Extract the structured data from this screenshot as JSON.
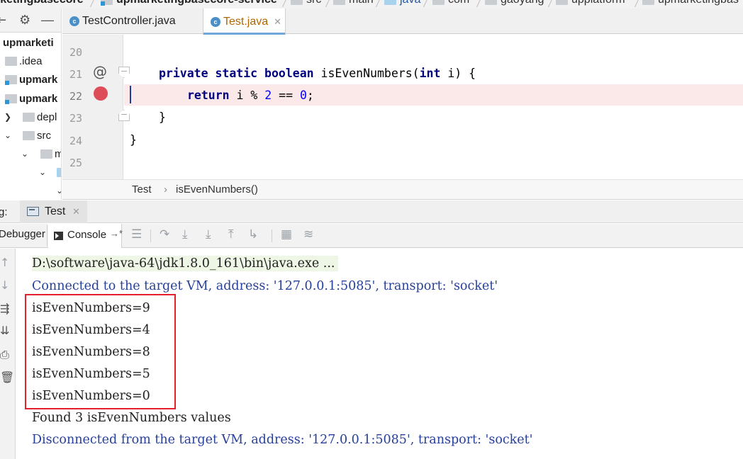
{
  "navbar": {
    "crumbs": [
      {
        "label": "rketingbasecore",
        "kind": "module"
      },
      {
        "label": "upmarketingbasecore-service",
        "kind": "module"
      },
      {
        "label": "src",
        "kind": "folder"
      },
      {
        "label": "main",
        "kind": "folder"
      },
      {
        "label": "java",
        "kind": "source"
      },
      {
        "label": "com",
        "kind": "folder"
      },
      {
        "label": "gaoyang",
        "kind": "folder"
      },
      {
        "label": "upplatform",
        "kind": "folder"
      },
      {
        "label": "upmarketingbas",
        "kind": "folder"
      }
    ]
  },
  "project": {
    "toolbar": {
      "collapse": "⇤",
      "settings": "⚙",
      "hide": "—"
    },
    "items": [
      {
        "label": "upmarketi",
        "bold": true,
        "arrow": ""
      },
      {
        "label": ".idea",
        "bold": false,
        "arrow": ""
      },
      {
        "label": "upmark",
        "bold": true,
        "arrow": ""
      },
      {
        "label": "upmark",
        "bold": true,
        "arrow": ""
      },
      {
        "label": "depl",
        "bold": false,
        "arrow": "❯"
      },
      {
        "label": "src",
        "bold": false,
        "arrow": "⌄"
      },
      {
        "label": "m",
        "bold": false,
        "arrow": "⌄"
      },
      {
        "label": "",
        "bold": false,
        "arrow": "⌄"
      },
      {
        "label": "",
        "bold": false,
        "arrow": "⌄"
      }
    ]
  },
  "tabs": [
    {
      "label": "TestController.java",
      "icon": "class-icon",
      "active": false
    },
    {
      "label": "Test.java",
      "icon": "class-icon",
      "active": true
    }
  ],
  "editor": {
    "lines": [
      {
        "num": "20",
        "code": ""
      },
      {
        "num": "21",
        "code": "private static boolean isEvenNumbers(int i) {"
      },
      {
        "num": "22",
        "code": "return i % 2 == 0;"
      },
      {
        "num": "23",
        "code": "}"
      },
      {
        "num": "24",
        "code": "}"
      },
      {
        "num": "25",
        "code": ""
      }
    ],
    "tokens": {
      "private": "private",
      "static": "static",
      "boolean": "boolean",
      "method_sig": "isEvenNumbers(",
      "int": "int",
      "param": "i) {",
      "return": "return",
      "expr_a": "i % ",
      "two": "2",
      "eq": " == ",
      "zero": "0",
      "semi": ";",
      "brace": "}"
    },
    "annotation_glyph": "@",
    "breakpoint_line": "22",
    "colors": {
      "keyword": "#000080",
      "number": "#0000ff",
      "breakpoint": "#de4d57",
      "breakpoint_line_bg": "#fbe8e8"
    }
  },
  "editor_breadcrumb": {
    "class_name": "Test",
    "separator": "›",
    "method_name": "isEvenNumbers()"
  },
  "debug": {
    "label_prefix": "g:",
    "run_tab": {
      "label": "Test",
      "close": "✕"
    },
    "debugger_tab": "Debugger",
    "console_tab": {
      "label": "Console",
      "pin": "→*"
    }
  },
  "console": {
    "lines": [
      {
        "text": "D:\\software\\java-64\\jdk1.8.0_161\\bin\\java.exe ...",
        "type": "cmd"
      },
      {
        "text": "Connected to the target VM, address: '127.0.0.1:5085', transport: 'socket'",
        "type": "sys"
      },
      {
        "text": "isEvenNumbers=9",
        "type": "out"
      },
      {
        "text": "isEvenNumbers=4",
        "type": "out"
      },
      {
        "text": "isEvenNumbers=8",
        "type": "out"
      },
      {
        "text": "isEvenNumbers=5",
        "type": "out"
      },
      {
        "text": "isEvenNumbers=0",
        "type": "out"
      },
      {
        "text": "Found 3 isEvenNumbers values",
        "type": "out"
      },
      {
        "text": "Disconnected from the target VM, address: '127.0.0.1:5085', transport: 'socket'",
        "type": "sys"
      }
    ],
    "highlight_color": "#e5202d"
  }
}
